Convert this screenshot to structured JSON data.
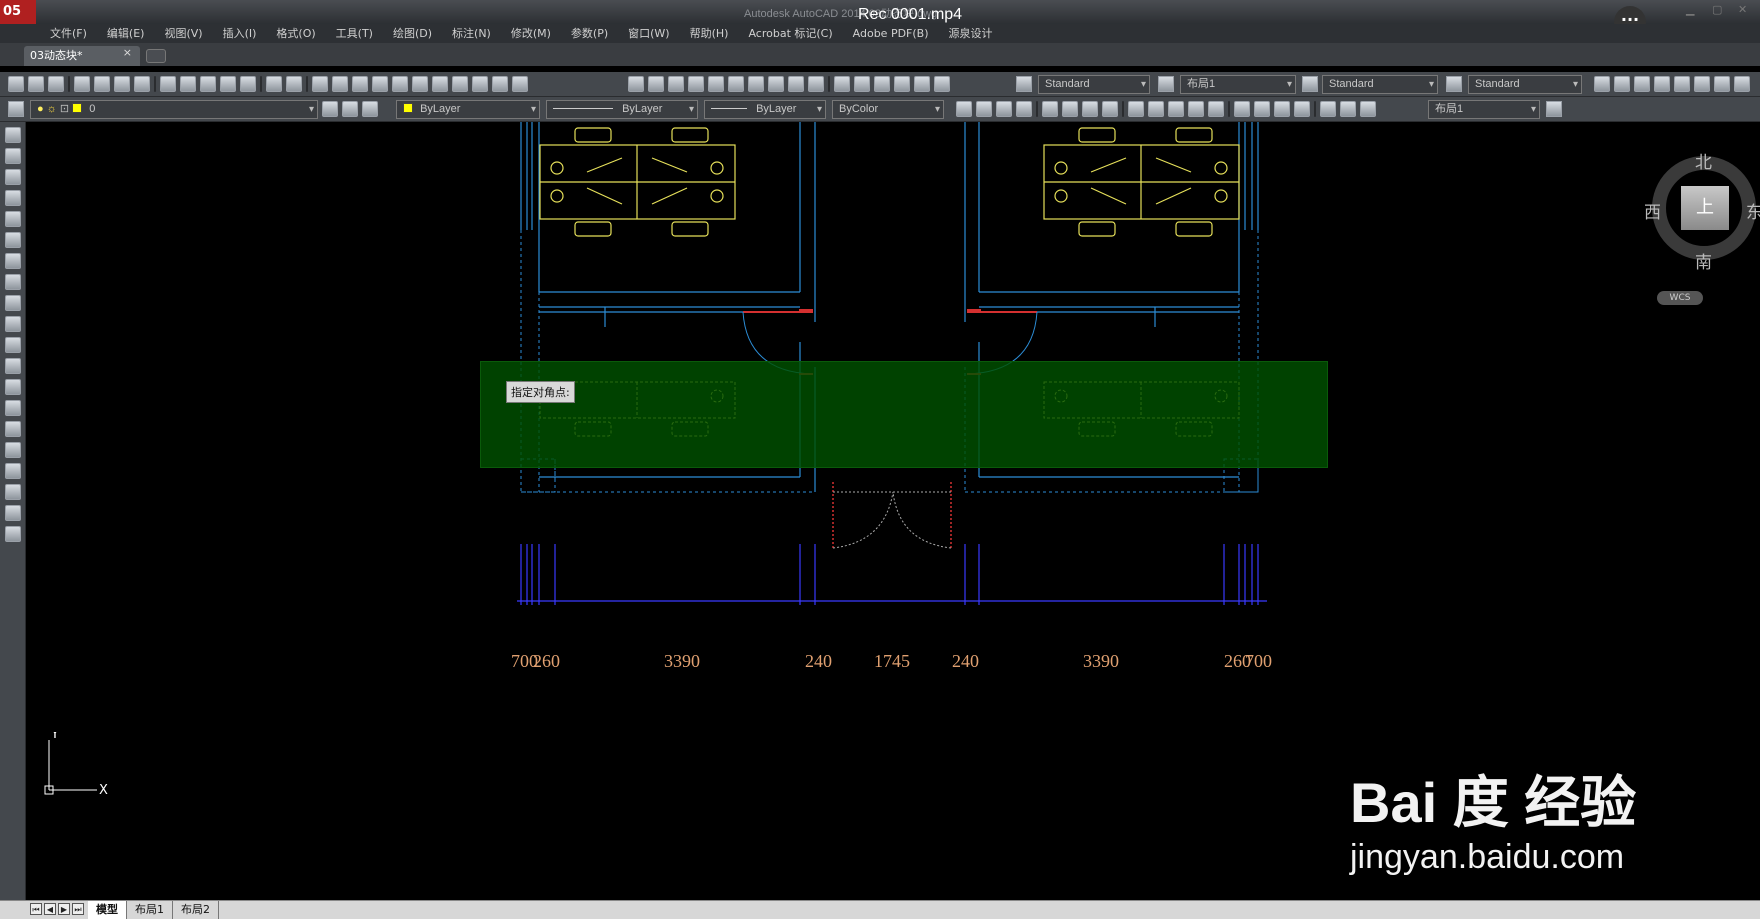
{
  "titlebar": {
    "logo_text": "05",
    "app_title": "Autodesk AutoCAD 2014   03动态块.dwg",
    "video_title": "Rec 0001.mp4",
    "more_label": "···"
  },
  "menu": [
    "文件(F)",
    "编辑(E)",
    "视图(V)",
    "插入(I)",
    "格式(O)",
    "工具(T)",
    "绘图(D)",
    "标注(N)",
    "修改(M)",
    "参数(P)",
    "窗口(W)",
    "帮助(H)",
    "Acrobat 标记(C)",
    "Adobe PDF(B)",
    "源泉设计"
  ],
  "tabs": {
    "file_tab": "03动态块*",
    "close_glyph": "×"
  },
  "toolbar1": {
    "text_style": "Standard",
    "layout": "布局1",
    "table_style": "Standard",
    "multileader_style": "Standard"
  },
  "toolbar2": {
    "layer": "0",
    "color": "ByLayer",
    "linetype": "ByLayer",
    "lineweight": "ByLayer",
    "plot_style": "ByColor",
    "layout": "布局1"
  },
  "drawing": {
    "tooltip": "指定对角点:",
    "dimensions": [
      "700",
      "260",
      "3390",
      "240",
      "1745",
      "240",
      "3390",
      "260",
      "700"
    ]
  },
  "viewcube": {
    "north": "北",
    "south": "南",
    "west": "西",
    "east": "东",
    "face": "上",
    "wcs": "WCS"
  },
  "ucs": {
    "x_label": "X",
    "y_label": "Y"
  },
  "watermark": {
    "brand": "Bai 度 经验",
    "url": "jingyan.baidu.com"
  },
  "layout_tabs": [
    "模型",
    "布局1",
    "布局2"
  ],
  "colors": {
    "wall": "#2c8dd6",
    "furniture": "#e6e05a",
    "door": "#d43030",
    "dimension_line": "#3a3aff",
    "dimension_text": "#e0a070",
    "selection": "#005000"
  }
}
